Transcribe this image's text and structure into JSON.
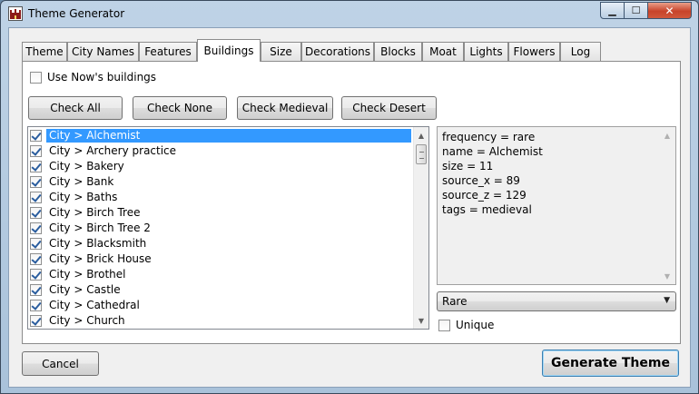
{
  "window": {
    "title": "Theme Generator",
    "minimize_icon": "minimize-icon",
    "maximize_icon": "maximize-icon",
    "close_icon": "close-icon"
  },
  "tabs": [
    {
      "label": "Theme",
      "active": false
    },
    {
      "label": "City Names",
      "active": false
    },
    {
      "label": "Features",
      "active": false
    },
    {
      "label": "Buildings",
      "active": true
    },
    {
      "label": "Size",
      "active": false
    },
    {
      "label": "Decorations",
      "active": false
    },
    {
      "label": "Blocks",
      "active": false
    },
    {
      "label": "Moat",
      "active": false
    },
    {
      "label": "Lights",
      "active": false
    },
    {
      "label": "Flowers",
      "active": false
    },
    {
      "label": "Log",
      "active": false
    }
  ],
  "buildings_tab": {
    "use_now_label": "Use Now's buildings",
    "use_now_checked": false,
    "buttons": {
      "check_all": "Check All",
      "check_none": "Check None",
      "check_medieval": "Check Medieval",
      "check_desert": "Check Desert"
    },
    "list": [
      {
        "label": "City > Alchemist",
        "checked": true,
        "selected": true
      },
      {
        "label": "City > Archery practice",
        "checked": true,
        "selected": false
      },
      {
        "label": "City > Bakery",
        "checked": true,
        "selected": false
      },
      {
        "label": "City > Bank",
        "checked": true,
        "selected": false
      },
      {
        "label": "City > Baths",
        "checked": true,
        "selected": false
      },
      {
        "label": "City > Birch Tree",
        "checked": true,
        "selected": false
      },
      {
        "label": "City > Birch Tree 2",
        "checked": true,
        "selected": false
      },
      {
        "label": "City > Blacksmith",
        "checked": true,
        "selected": false
      },
      {
        "label": "City > Brick House",
        "checked": true,
        "selected": false
      },
      {
        "label": "City > Brothel",
        "checked": true,
        "selected": false
      },
      {
        "label": "City > Castle",
        "checked": true,
        "selected": false
      },
      {
        "label": "City > Cathedral",
        "checked": true,
        "selected": false
      },
      {
        "label": "City > Church",
        "checked": true,
        "selected": false
      }
    ],
    "properties": [
      "frequency = rare",
      "name = Alchemist",
      "size = 11",
      "source_x = 89",
      "source_z = 129",
      "tags = medieval"
    ],
    "frequency_select": {
      "value": "Rare"
    },
    "unique_label": "Unique",
    "unique_checked": false
  },
  "footer": {
    "cancel": "Cancel",
    "generate": "Generate Theme"
  }
}
